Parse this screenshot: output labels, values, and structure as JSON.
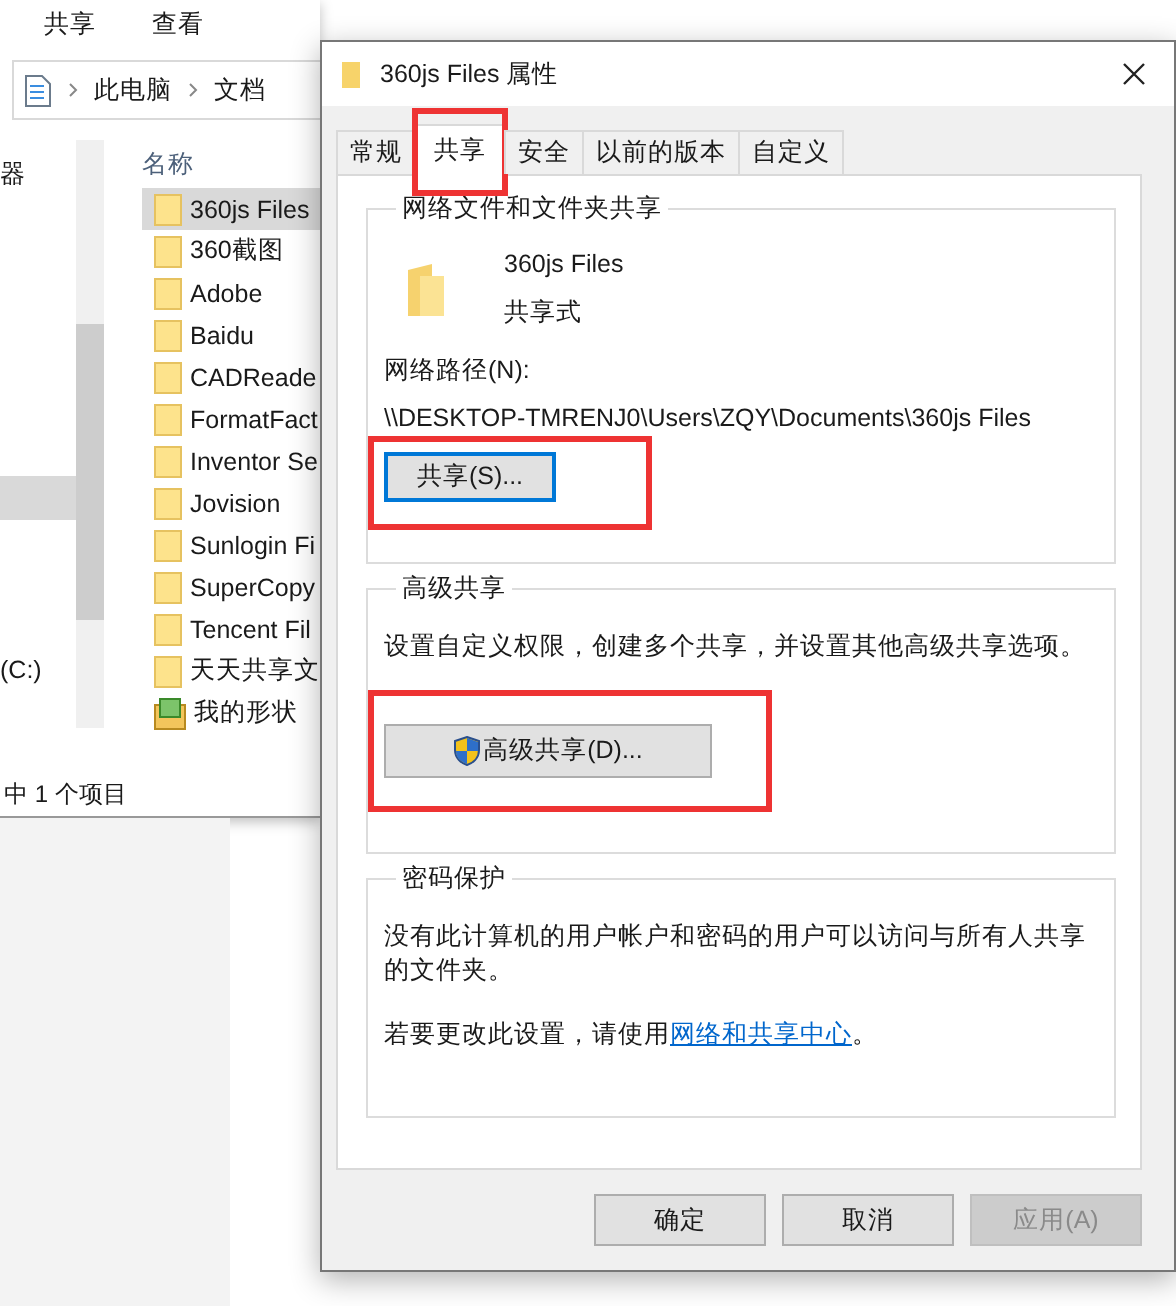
{
  "explorer": {
    "ribbon_tabs": [
      "共享",
      "查看"
    ],
    "breadcrumb": [
      "此电脑",
      "文档"
    ],
    "nav_pane": {
      "items": [
        {
          "label": "器",
          "selected": false
        },
        {
          "selected": true
        },
        {
          "label": "(C:)",
          "selected": false
        }
      ]
    },
    "file_list": {
      "header": "名称",
      "items": [
        {
          "name": "360js Files",
          "kind": "folder",
          "selected": true
        },
        {
          "name": "360截图",
          "kind": "folder",
          "selected": false
        },
        {
          "name": "Adobe",
          "kind": "folder",
          "selected": false
        },
        {
          "name": "Baidu",
          "kind": "folder",
          "selected": false
        },
        {
          "name": "CADReade",
          "kind": "folder",
          "selected": false
        },
        {
          "name": "FormatFact",
          "kind": "folder",
          "selected": false
        },
        {
          "name": "Inventor Se",
          "kind": "folder",
          "selected": false
        },
        {
          "name": "Jovision",
          "kind": "folder",
          "selected": false
        },
        {
          "name": "Sunlogin Fi",
          "kind": "folder",
          "selected": false
        },
        {
          "name": "SuperCopy",
          "kind": "folder",
          "selected": false
        },
        {
          "name": "Tencent Fil",
          "kind": "folder",
          "selected": false
        },
        {
          "name": "天天共享文",
          "kind": "folder",
          "selected": false
        },
        {
          "name": "我的形状",
          "kind": "shapes",
          "selected": false
        }
      ]
    },
    "status_bar": "中 1 个项目"
  },
  "dialog": {
    "title": "360js Files 属性",
    "tabs": [
      {
        "label": "常规",
        "selected": false,
        "highlighted": false
      },
      {
        "label": "共享",
        "selected": true,
        "highlighted": true
      },
      {
        "label": "安全",
        "selected": false,
        "highlighted": false
      },
      {
        "label": "以前的版本",
        "selected": false,
        "highlighted": false
      },
      {
        "label": "自定义",
        "selected": false,
        "highlighted": false
      }
    ],
    "network_sharing": {
      "title": "网络文件和文件夹共享",
      "folder_name": "360js Files",
      "share_state": "共享式",
      "path_label": "网络路径(N):",
      "path": "\\\\DESKTOP-TMRENJ0\\Users\\ZQY\\Documents\\360js Files",
      "button": {
        "label": "共享(S)...",
        "focused": true,
        "highlighted": true
      }
    },
    "advanced_sharing": {
      "title": "高级共享",
      "description": "设置自定义权限，创建多个共享，并设置其他高级共享选项。",
      "button": {
        "label": "高级共享(D)...",
        "highlighted": true
      }
    },
    "password_protection": {
      "title": "密码保护",
      "description": "没有此计算机的用户帐户和密码的用户可以访问与所有人共享的文件夹。",
      "hint": "若要更改此设置，请使用",
      "link": "网络和共享中心",
      "hint_end": "。"
    },
    "buttons": [
      {
        "label": "确定",
        "disabled": false
      },
      {
        "label": "取消",
        "disabled": false
      },
      {
        "label": "应用(A)",
        "disabled": true
      }
    ]
  }
}
